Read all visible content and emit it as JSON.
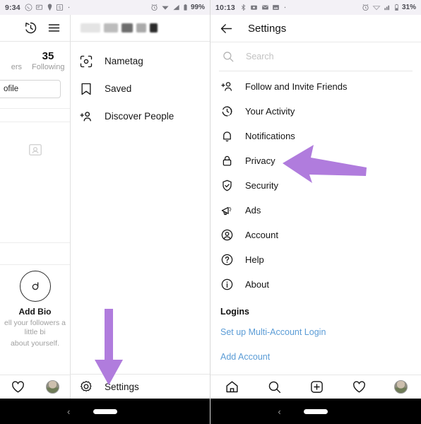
{
  "accent": {
    "arrow_purple": "#b07cdd",
    "link_blue": "#5b9cd6"
  },
  "left_panel": {
    "status_bar": {
      "clock": "9:34",
      "battery": "99%",
      "icons": [
        "whatsapp-icon",
        "message-icon",
        "location-icon",
        "s-badge-icon",
        "dot-icon"
      ],
      "right_icons": [
        "alarm-icon",
        "wifi-icon",
        "signal-icon",
        "battery-icon"
      ]
    },
    "topbar": {
      "history_icon": "clock-history-icon",
      "menu_icon": "hamburger-menu-icon",
      "redacted_username": ""
    },
    "profile": {
      "stat_following_value": "35",
      "stat_following_label": "Following",
      "stat_followers_label": "ers",
      "edit_profile_label": "ofile",
      "bio_title": "Add Bio",
      "bio_subtitle_line1": "ell your followers a little bi",
      "bio_subtitle_line2": "about yourself.",
      "placeholder_icon": "contact-card-icon"
    },
    "menu_items": [
      {
        "label": "Nametag",
        "icon": "nametag-icon"
      },
      {
        "label": "Saved",
        "icon": "bookmark-icon"
      },
      {
        "label": "Discover People",
        "icon": "add-person-icon"
      }
    ],
    "settings_item": {
      "label": "Settings",
      "icon": "gear-icon"
    },
    "bottom_nav": [
      {
        "icon": "heart-icon"
      },
      {
        "icon": "avatar"
      }
    ],
    "android_nav": {
      "back": "‹",
      "pill": "home-pill"
    }
  },
  "right_panel": {
    "status_bar": {
      "clock": "10:13",
      "battery": "31%",
      "icons": [
        "bluetooth-icon",
        "camera-icon",
        "mail-icon",
        "photo-icon",
        "dot-icon"
      ],
      "right_icons": [
        "alarm-icon",
        "wifi-icon",
        "signal-icon",
        "battery-icon"
      ]
    },
    "header": {
      "back_icon": "back-arrow-icon",
      "title": "Settings"
    },
    "search": {
      "icon": "search-icon",
      "placeholder": "Search",
      "value": ""
    },
    "items": [
      {
        "label": "Follow and Invite Friends",
        "icon": "add-person-icon"
      },
      {
        "label": "Your Activity",
        "icon": "activity-clock-icon"
      },
      {
        "label": "Notifications",
        "icon": "bell-icon"
      },
      {
        "label": "Privacy",
        "icon": "lock-icon"
      },
      {
        "label": "Security",
        "icon": "shield-check-icon"
      },
      {
        "label": "Ads",
        "icon": "megaphone-icon"
      },
      {
        "label": "Account",
        "icon": "account-circle-icon"
      },
      {
        "label": "Help",
        "icon": "help-circle-icon"
      },
      {
        "label": "About",
        "icon": "info-circle-icon"
      }
    ],
    "logins_section": {
      "title": "Logins",
      "links": [
        {
          "label": "Set up Multi-Account Login"
        },
        {
          "label": "Add Account"
        }
      ]
    },
    "bottom_nav": [
      {
        "icon": "home-icon"
      },
      {
        "icon": "search-icon"
      },
      {
        "icon": "add-post-icon"
      },
      {
        "icon": "heart-icon"
      },
      {
        "icon": "avatar"
      }
    ],
    "android_nav": {
      "back": "‹",
      "pill": "home-pill"
    }
  },
  "annotations": [
    {
      "name": "arrow-to-privacy",
      "direction": "left",
      "color": "#b07cdd"
    },
    {
      "name": "arrow-to-settings",
      "direction": "down",
      "color": "#b07cdd"
    }
  ]
}
